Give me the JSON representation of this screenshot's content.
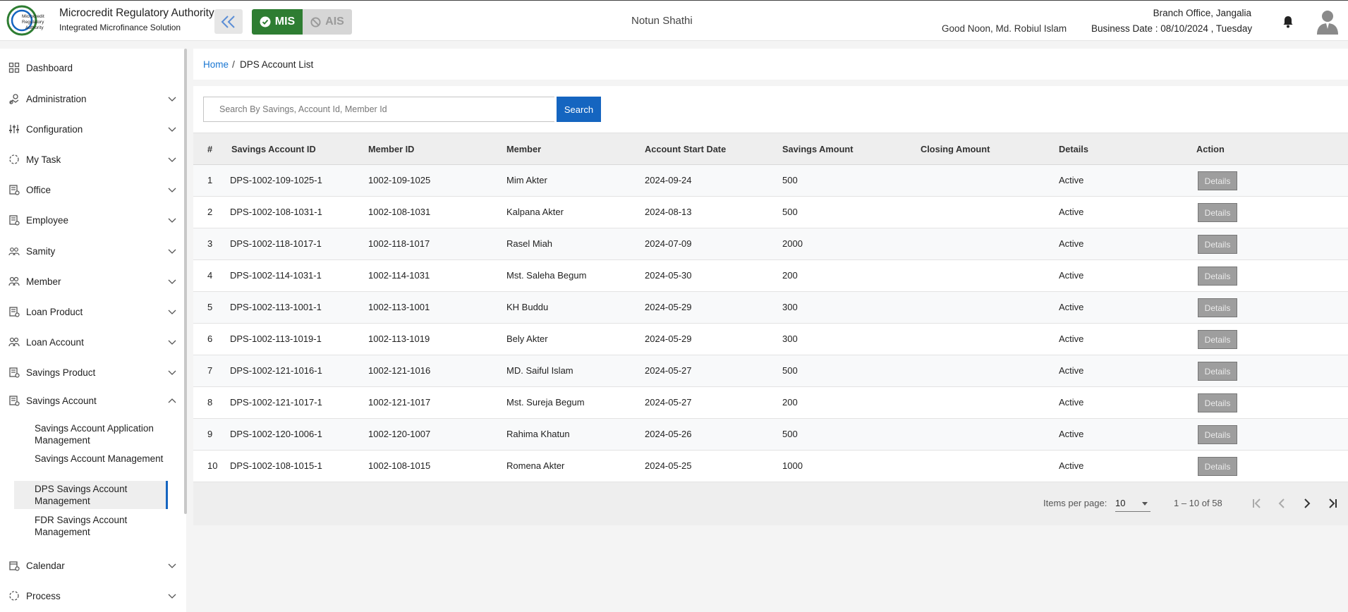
{
  "header": {
    "brand_title": "Microcredit Regulatory Authority",
    "brand_subtitle": "Integrated Microfinance Solution",
    "logo_text": "Microcredit Regulatory Authority",
    "mode_mis": "MIS",
    "mode_ais": "AIS",
    "org_name": "Notun Shathi",
    "greeting": "Good Noon, Md. Robiul Islam",
    "branch": "Branch Office, Jangalia",
    "business_date": "Business Date : 08/10/2024 , Tuesday"
  },
  "sidebar": {
    "items": [
      {
        "label": "Dashboard",
        "icon": "grid-icon"
      },
      {
        "label": "Administration",
        "icon": "admin-icon"
      },
      {
        "label": "Configuration",
        "icon": "sliders-icon"
      },
      {
        "label": "My Task",
        "icon": "task-icon"
      },
      {
        "label": "Office",
        "icon": "office-icon"
      },
      {
        "label": "Employee",
        "icon": "employee-icon"
      },
      {
        "label": "Samity",
        "icon": "samity-icon"
      },
      {
        "label": "Member",
        "icon": "member-icon"
      },
      {
        "label": "Loan Product",
        "icon": "product-icon"
      },
      {
        "label": "Loan Account",
        "icon": "users-icon"
      },
      {
        "label": "Savings Product",
        "icon": "product-icon"
      },
      {
        "label": "Savings Account",
        "icon": "product-icon"
      },
      {
        "label": "Calendar",
        "icon": "calendar-icon"
      },
      {
        "label": "Process",
        "icon": "process-icon"
      }
    ],
    "savings_sub": [
      {
        "label": "Savings Account Application Management"
      },
      {
        "label": "Savings Account Management"
      },
      {
        "label": "DPS Savings Account Management"
      },
      {
        "label": "FDR Savings Account Management"
      }
    ]
  },
  "breadcrumb": {
    "home": "Home",
    "separator": "/",
    "current": "DPS Account List"
  },
  "search": {
    "placeholder": "Search By Savings, Account Id, Member Id",
    "button": "Search"
  },
  "table": {
    "columns": [
      "#",
      "Savings Account ID",
      "Member ID",
      "Member",
      "Account Start Date",
      "Savings Amount",
      "Closing Amount",
      "Details",
      "Action"
    ],
    "action_label": "Details",
    "rows": [
      {
        "n": "1",
        "acc": "DPS-1002-109-1025-1",
        "mid": "1002-109-1025",
        "member": "Mim Akter",
        "start": "2024-09-24",
        "amount": "500",
        "closing": "",
        "status": "Active"
      },
      {
        "n": "2",
        "acc": "DPS-1002-108-1031-1",
        "mid": "1002-108-1031",
        "member": "Kalpana Akter",
        "start": "2024-08-13",
        "amount": "500",
        "closing": "",
        "status": "Active"
      },
      {
        "n": "3",
        "acc": "DPS-1002-118-1017-1",
        "mid": "1002-118-1017",
        "member": "Rasel Miah",
        "start": "2024-07-09",
        "amount": "2000",
        "closing": "",
        "status": "Active"
      },
      {
        "n": "4",
        "acc": "DPS-1002-114-1031-1",
        "mid": "1002-114-1031",
        "member": "Mst. Saleha Begum",
        "start": "2024-05-30",
        "amount": "200",
        "closing": "",
        "status": "Active"
      },
      {
        "n": "5",
        "acc": "DPS-1002-113-1001-1",
        "mid": "1002-113-1001",
        "member": "KH Buddu",
        "start": "2024-05-29",
        "amount": "300",
        "closing": "",
        "status": "Active"
      },
      {
        "n": "6",
        "acc": "DPS-1002-113-1019-1",
        "mid": "1002-113-1019",
        "member": "Bely Akter",
        "start": "2024-05-29",
        "amount": "300",
        "closing": "",
        "status": "Active"
      },
      {
        "n": "7",
        "acc": "DPS-1002-121-1016-1",
        "mid": "1002-121-1016",
        "member": "MD. Saiful Islam",
        "start": "2024-05-27",
        "amount": "500",
        "closing": "",
        "status": "Active"
      },
      {
        "n": "8",
        "acc": "DPS-1002-121-1017-1",
        "mid": "1002-121-1017",
        "member": "Mst. Sureja Begum",
        "start": "2024-05-27",
        "amount": "200",
        "closing": "",
        "status": "Active"
      },
      {
        "n": "9",
        "acc": "DPS-1002-120-1006-1",
        "mid": "1002-120-1007",
        "member": "Rahima Khatun",
        "start": "2024-05-26",
        "amount": "500",
        "closing": "",
        "status": "Active"
      },
      {
        "n": "10",
        "acc": "DPS-1002-108-1015-1",
        "mid": "1002-108-1015",
        "member": "Romena Akter",
        "start": "2024-05-25",
        "amount": "1000",
        "closing": "",
        "status": "Active"
      }
    ]
  },
  "pagination": {
    "items_per_page_label": "Items per page:",
    "items_per_page": "10",
    "range": "1 – 10 of 58"
  },
  "colors": {
    "primary": "#1565c0",
    "mis_green": "#2e7d32",
    "link": "#1976d2"
  }
}
